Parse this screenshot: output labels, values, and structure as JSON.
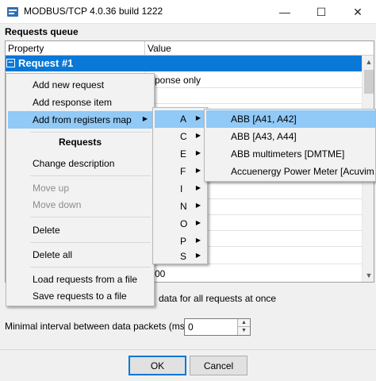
{
  "window": {
    "title": "MODBUS/TCP 4.0.36 build 1222",
    "minimize_glyph": "—",
    "maximize_glyph": "☐",
    "close_glyph": "✕"
  },
  "queue": {
    "label": "Requests queue",
    "col_property": "Property",
    "col_value": "Value",
    "request_title": "Request #1",
    "expander_glyph": "−",
    "cell_response": "ponse only",
    "cell_zero_tail": "00"
  },
  "scroll": {
    "up_glyph": "▲",
    "down_glyph": "▼"
  },
  "options": {
    "checkbox_label_tail": "data for all requests at once",
    "interval_label": "Minimal interval between data packets (ms)",
    "interval_value": "0",
    "spin_up_glyph": "▲",
    "spin_down_glyph": "▼"
  },
  "buttons": {
    "ok": "OK",
    "cancel": "Cancel"
  },
  "context_menu": {
    "items": [
      {
        "label": "Add new request"
      },
      {
        "label": "Add response item"
      },
      {
        "label": "Add from registers map",
        "arrow": "▶"
      },
      {
        "label": "Requests"
      },
      {
        "label": "Change description"
      },
      {
        "label": "Move up"
      },
      {
        "label": "Move down"
      },
      {
        "label": "Delete"
      },
      {
        "label": "Delete all"
      },
      {
        "label": "Load requests from a file"
      },
      {
        "label": "Save requests to a file"
      }
    ]
  },
  "letters_menu": {
    "arrow": "▶",
    "items": [
      "A",
      "C",
      "E",
      "F",
      "I",
      "N",
      "O",
      "P",
      "S"
    ]
  },
  "abb_menu": {
    "items": [
      "ABB [A41, A42]",
      "ABB [A43, A44]",
      "ABB multimeters [DMTME]",
      "Accuenergy Power Meter [Acuvim L"
    ]
  },
  "colors": {
    "selection": "#0a78d7",
    "menu_highlight": "#91c9f7",
    "disabled_text": "#8d8d8d"
  }
}
